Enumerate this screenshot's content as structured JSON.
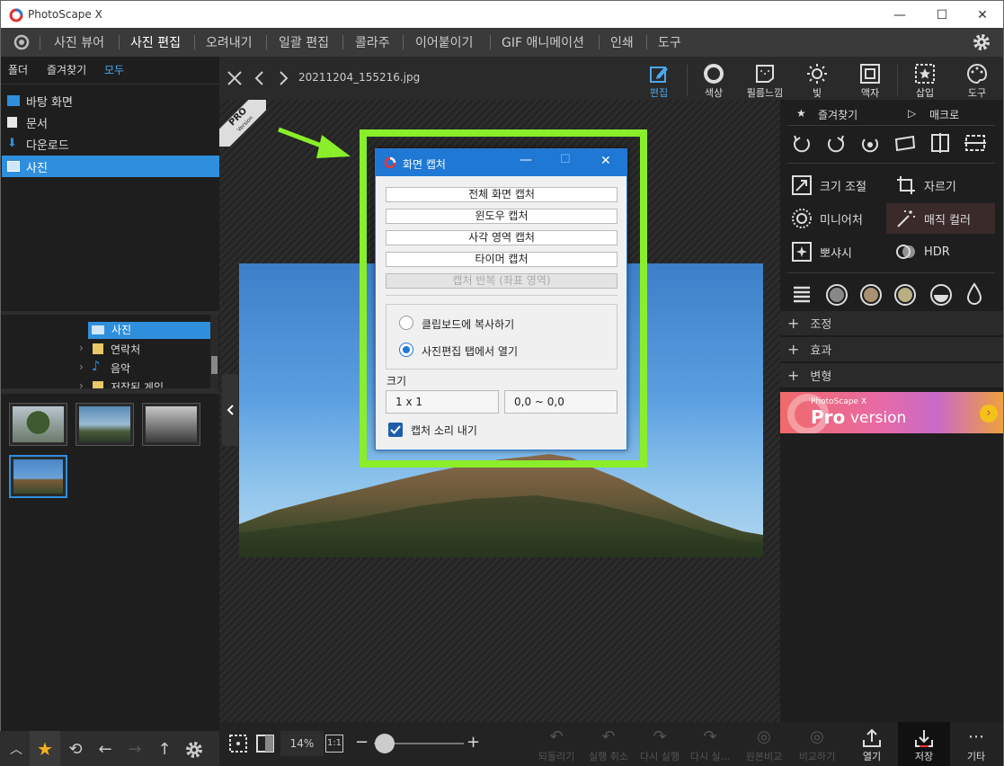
{
  "app": {
    "title": "PhotoScape X"
  },
  "menu": [
    "사진 뷰어",
    "사진 편집",
    "오려내기",
    "일괄 편집",
    "콜라주",
    "이어붙이기",
    "GIF 애니메이션",
    "인쇄",
    "도구"
  ],
  "menu_active": "사진 편집",
  "left": {
    "tabs": [
      "폴더",
      "즐겨찾기",
      "모두"
    ],
    "folders": [
      "바탕 화면",
      "문서",
      "다운로드",
      "사진"
    ],
    "tree": [
      "사진",
      "연락처",
      "음악",
      "저장된 게임"
    ]
  },
  "file": {
    "name": "20211204_155216.jpg"
  },
  "pro_badge": {
    "line1": "PRO",
    "line2": "Version"
  },
  "edit_tabs": [
    "편집",
    "색상",
    "필름느낌",
    "빛",
    "액자",
    "삽입",
    "도구"
  ],
  "right": {
    "favorites": "즐겨찾기",
    "macro": "매크로",
    "tools": {
      "resize": "크기 조절",
      "crop": "자르기",
      "miniature": "미니어처",
      "magic_color": "매직 컬러",
      "bloom": "뽀샤시",
      "hdr": "HDR"
    },
    "sections": [
      "조정",
      "효과",
      "변형"
    ],
    "banner": {
      "small": "PhotoScape X",
      "big1": "Pro",
      "big2": " version"
    }
  },
  "dialog": {
    "title": "화면 캡처",
    "buttons": [
      "전체 화면 캡처",
      "윈도우 캡처",
      "사각 영역 캡처",
      "타이머 캡처",
      "캡처 반복 (좌표 영역)"
    ],
    "radio1": "클립보드에 복사하기",
    "radio2": "사진편집 탭에서 열기",
    "size_label": "크기",
    "size_value": "1 x 1",
    "coord_value": "0,0 ~ 0,0",
    "checkbox": "캡처 소리 내기"
  },
  "bottom": {
    "zoom": "14%",
    "ratio": "1:1",
    "buttons": [
      "되돌리기",
      "실행 취소",
      "다시 실행",
      "다시 실...",
      "원본비교",
      "비교하기",
      "열기",
      "저장",
      "기타"
    ]
  },
  "colors": {
    "accent": "#2f8fdd",
    "highlight": "#8aee2a",
    "dialog_title": "#1e78d4"
  }
}
